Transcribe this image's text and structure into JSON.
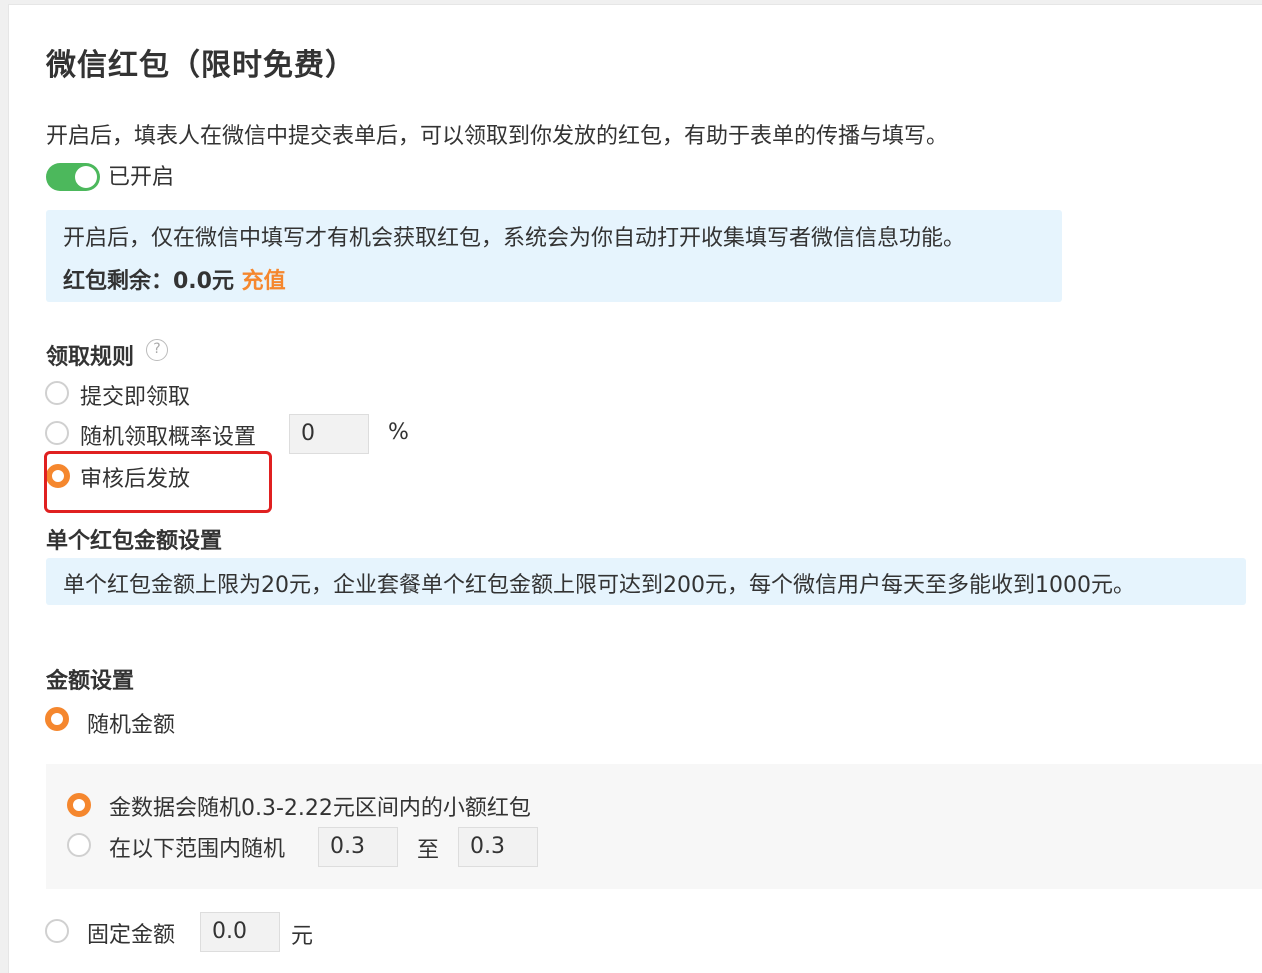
{
  "header": {
    "title": "微信红包（限时免费）",
    "description": "开启后，填表人在微信中提交表单后，可以领取到你发放的红包，有助于表单的传播与填写。"
  },
  "toggle": {
    "state": true,
    "label": "已开启",
    "color": "#4cb85c"
  },
  "info_box": {
    "line1": "开启后，仅在微信中填写才有机会获取红包，系统会为你自动打开收集填写者微信信息功能。",
    "balance_label": "红包剩余：0.0元",
    "recharge_link": "充值",
    "accent_color": "#f5872e"
  },
  "rules": {
    "title": "领取规则",
    "help_icon": "?",
    "options": [
      {
        "label": "提交即领取",
        "checked": false
      },
      {
        "label": "随机领取概率设置",
        "checked": false,
        "input_value": "0",
        "unit": "%"
      },
      {
        "label": "审核后发放",
        "checked": true
      }
    ]
  },
  "single_amount": {
    "title": "单个红包金额设置",
    "info": "单个红包金额上限为20元，企业套餐单个红包金额上限可达到200元，每个微信用户每天至多能收到1000元。"
  },
  "amount_settings": {
    "title": "金额设置",
    "random_label": "随机金额",
    "random_checked": true,
    "random_sub": [
      {
        "label": "金数据会随机0.3-2.22元区间内的小额红包",
        "checked": true
      },
      {
        "label": "在以下范围内随机",
        "checked": false,
        "min": "0.3",
        "separator": "至",
        "max": "0.3"
      }
    ],
    "fixed_label": "固定金额",
    "fixed_checked": false,
    "fixed_value": "0.0",
    "fixed_unit": "元"
  }
}
